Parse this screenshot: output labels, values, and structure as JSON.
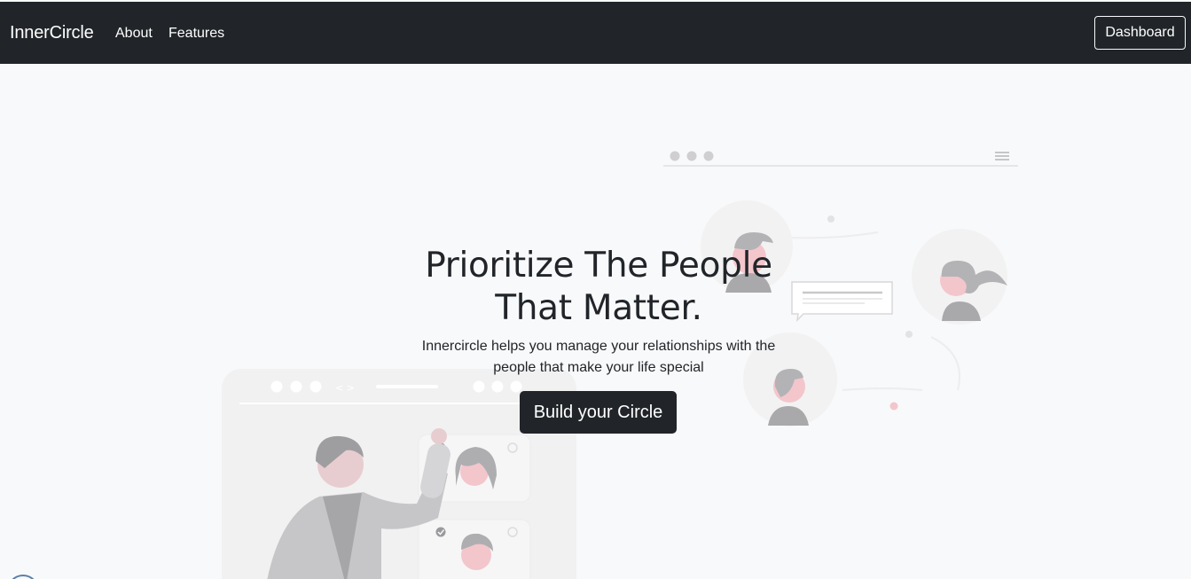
{
  "navbar": {
    "brand": "InnerCircle",
    "links": [
      {
        "label": "About"
      },
      {
        "label": "Features"
      }
    ],
    "dashboard_label": "Dashboard"
  },
  "hero": {
    "title_line1": "Prioritize The People",
    "title_line2": "That Matter.",
    "subtitle_line1": "Innercircle helps you manage your relationships with the",
    "subtitle_line2": "people that make your life special",
    "cta_label": "Build your Circle"
  },
  "colors": {
    "navbar_bg": "#212529",
    "page_bg": "#f8f9fa",
    "text": "#212529",
    "illustration_gray": "#c9c9cc",
    "illustration_pink": "#f3c6cc"
  }
}
